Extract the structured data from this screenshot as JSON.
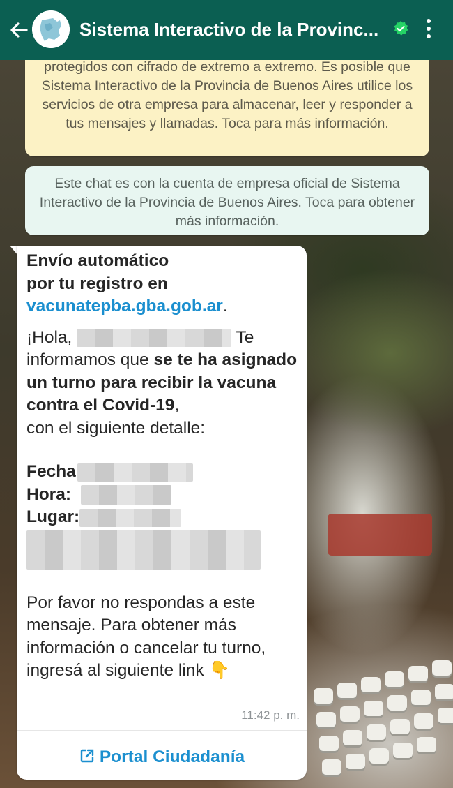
{
  "header": {
    "title": "Sistema Interactivo de la Provinc..."
  },
  "encryption_notice": {
    "text": "protegidos con cifrado de extremo a extremo. Es posible que Sistema Interactivo de la Provincia de Buenos Aires utilice los servicios de otra empresa para almacenar, leer y responder a tus mensajes y llamadas. Toca para más información."
  },
  "business_notice": {
    "text": "Este chat es con la cuenta de empresa oficial de Sistema Interactivo de la Provincia de Buenos Aires. Toca para obtener más información."
  },
  "message": {
    "line1": "Envío automático",
    "line2": "por tu registro en",
    "link": "vacunatepba.gba.gob.ar",
    "link_suffix": ".",
    "greeting": "¡Hola,",
    "greeting_after": "Te",
    "inform": "informamos que",
    "bold_part": "se te ha asignado un turno para recibir la vacuna contra el Covid-19",
    "after_bold": ",",
    "detail": "con el siguiente detalle:",
    "fecha_label": "Fecha",
    "hora_label": "Hora:",
    "lugar_label": "Lugar:",
    "closing": "Por favor no respondas a este mensaje. Para obtener más información o cancelar tu turno, ingresá al siguiente link",
    "emoji": "👇",
    "time": "11:42 p. m."
  },
  "portal_button": {
    "label": "Portal Ciudadanía"
  },
  "colors": {
    "header": "#0b5f52",
    "link": "#1b8fcf",
    "encryption_bg": "#fcf2c5",
    "business_bg": "#e8f6f1",
    "verified": "#25d366"
  }
}
